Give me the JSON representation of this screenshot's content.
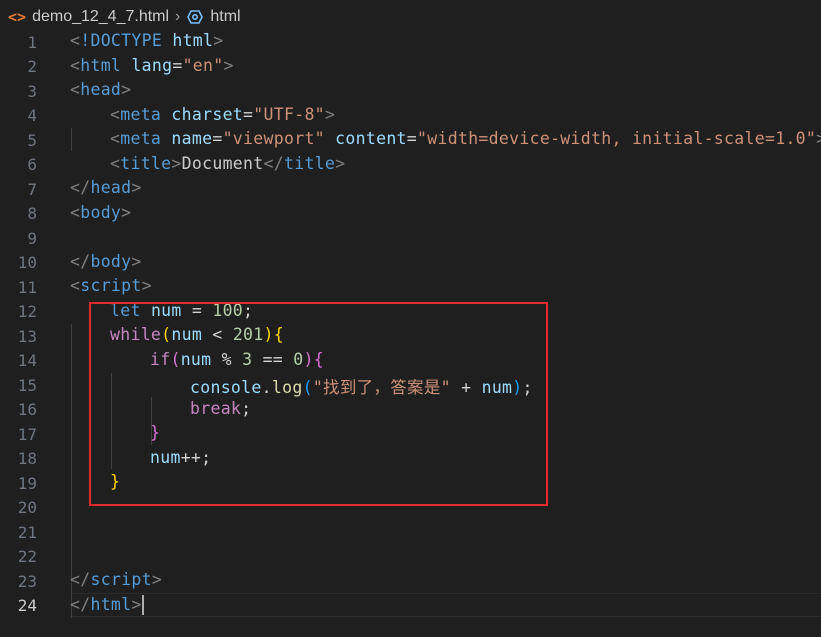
{
  "breadcrumb": {
    "file_icon": "html-file-icon",
    "file_name": "demo_12_4_7.html",
    "separator": "›",
    "symbol_icon": "symbol-class-icon",
    "symbol_name": "html"
  },
  "editor": {
    "current_line": 24,
    "line_numbers": [
      "1",
      "2",
      "3",
      "4",
      "5",
      "6",
      "7",
      "8",
      "9",
      "10",
      "11",
      "12",
      "13",
      "14",
      "15",
      "16",
      "17",
      "18",
      "19",
      "20",
      "21",
      "22",
      "23",
      "24"
    ],
    "lines": {
      "l1": {
        "br1": "<",
        "doctype": "!DOCTYPE",
        "sp": " ",
        "attr": "html",
        "br2": ">"
      },
      "l2": {
        "br1": "<",
        "tag": "html",
        "sp": " ",
        "attr": "lang",
        "eq": "=",
        "val": "\"en\"",
        "br2": ">"
      },
      "l3": {
        "br1": "<",
        "tag": "head",
        "br2": ">"
      },
      "l4": {
        "br1": "<",
        "tag": "meta",
        "sp": " ",
        "attr": "charset",
        "eq": "=",
        "val": "\"UTF-8\"",
        "br2": ">"
      },
      "l5": {
        "br1": "<",
        "tag": "meta",
        "sp1": " ",
        "attr1": "name",
        "eq1": "=",
        "val1": "\"viewport\"",
        "sp2": " ",
        "attr2": "content",
        "eq2": "=",
        "val2": "\"width=device-width, initial-scale=1.0\"",
        "br2": ">"
      },
      "l6": {
        "br1": "<",
        "tag1": "title",
        "br2": ">",
        "text": "Document",
        "br3": "</",
        "tag2": "title",
        "br4": ">"
      },
      "l7": {
        "br1": "</",
        "tag": "head",
        "br2": ">"
      },
      "l8": {
        "br1": "<",
        "tag": "body",
        "br2": ">"
      },
      "l10": {
        "br1": "</",
        "tag": "body",
        "br2": ">"
      },
      "l11": {
        "br1": "<",
        "tag": "script",
        "br2": ">"
      },
      "l12": {
        "kw": "let",
        "sp1": " ",
        "var": "num",
        "op": " = ",
        "num": "100",
        "semi": ";"
      },
      "l13": {
        "kw": "while",
        "p1": "(",
        "var": "num",
        "op": " < ",
        "num": "201",
        "p2": ")",
        "b1": "{"
      },
      "l14": {
        "kw": "if",
        "p1": "(",
        "var": "num",
        "op1": " % ",
        "num1": "3",
        "op2": " == ",
        "num2": "0",
        "p2": ")",
        "b1": "{"
      },
      "l15": {
        "obj": "console",
        "dot": ".",
        "fn": "log",
        "p1": "(",
        "str": "\"找到了，答案是\"",
        "op": " + ",
        "var": "num",
        "p2": ")",
        "semi": ";"
      },
      "l16": {
        "kw": "break",
        "semi": ";"
      },
      "l17": {
        "b1": "}"
      },
      "l18": {
        "var": "num",
        "op": "++",
        "semi": ";"
      },
      "l19": {
        "b1": "}"
      },
      "l23": {
        "br1": "</",
        "tag": "script",
        "br2": ">"
      },
      "l24": {
        "br1": "</",
        "tag": "html",
        "br2": ">"
      }
    }
  },
  "colors": {
    "background": "#1f1f1f",
    "highlight_box": "#e22c2c",
    "tag": "#569cd6",
    "attribute": "#9cdcfe",
    "string": "#ce9178",
    "control_keyword": "#c586c0",
    "number": "#b5cea8",
    "function": "#dcdcaa"
  }
}
